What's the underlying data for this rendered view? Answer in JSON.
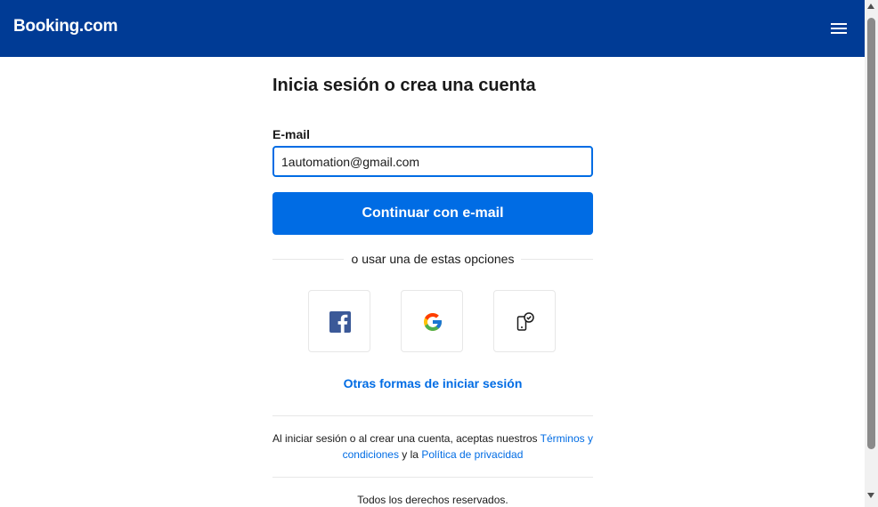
{
  "header": {
    "logo": "Booking.com",
    "background_color": "#003b95",
    "menu_icon": "hamburger-menu-icon"
  },
  "signin": {
    "title": "Inicia sesión o crea una cuenta",
    "email_label": "E-mail",
    "email_value": "1automation@gmail.com",
    "continue_button": "Continuar con e-mail",
    "divider_text": "o usar una de estas opciones",
    "social_options": [
      {
        "name": "Facebook",
        "icon": "facebook-icon"
      },
      {
        "name": "Google",
        "icon": "google-icon"
      },
      {
        "name": "Phone",
        "icon": "phone-check-icon"
      }
    ],
    "other_methods_link": "Otras formas de iniciar sesión"
  },
  "terms": {
    "text_before": "Al iniciar sesión o al crear una cuenta, aceptas nuestros ",
    "terms_link": "Términos y condiciones",
    "text_middle": " y la ",
    "privacy_link": "Política de privacidad"
  },
  "footer": {
    "rights": "Todos los derechos reservados."
  },
  "colors": {
    "primary": "#006ce4",
    "brand_dark": "#003b95"
  }
}
